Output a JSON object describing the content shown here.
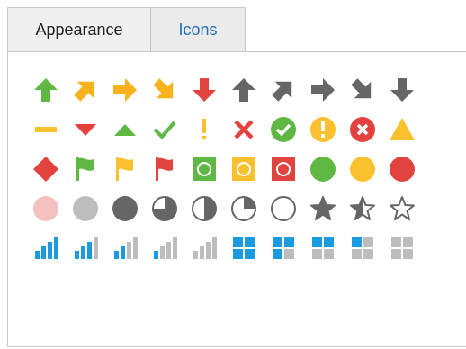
{
  "tabs": [
    {
      "label": "Appearance",
      "active": false
    },
    {
      "label": "Icons",
      "active": true
    }
  ],
  "colors": {
    "green": "#5fb843",
    "orange": "#f7b21e",
    "yellow": "#fbc02d",
    "red": "#e3433f",
    "gray": "#666666",
    "lightgray": "#bdbdbd",
    "pink": "#f4c0c0",
    "blue": "#1a9be0"
  },
  "icon_rows": [
    [
      "arrow-up-green-icon",
      "arrow-up-right-orange-icon",
      "arrow-right-orange-icon",
      "arrow-down-right-orange-icon",
      "arrow-down-red-icon",
      "arrow-up-gray-icon",
      "arrow-up-right-gray-icon",
      "arrow-right-gray-icon",
      "arrow-down-right-gray-icon",
      "arrow-down-gray-icon"
    ],
    [
      "dash-yellow-icon",
      "triangle-down-red-icon",
      "triangle-up-green-icon",
      "checkmark-green-icon",
      "exclamation-yellow-icon",
      "x-red-icon",
      "check-circle-green-icon",
      "exclamation-circle-yellow-icon",
      "x-circle-red-icon",
      "triangle-yellow-icon"
    ],
    [
      "diamond-red-icon",
      "flag-green-icon",
      "flag-yellow-icon",
      "flag-red-icon",
      "square-circle-green-icon",
      "square-circle-yellow-icon",
      "square-circle-red-icon",
      "circle-green-icon",
      "circle-yellow-icon",
      "circle-red-icon"
    ],
    [
      "circle-pink-icon",
      "circle-lightgray-icon",
      "circle-darkgray-icon",
      "pie-three-quarter-icon",
      "pie-half-icon",
      "pie-quarter-icon",
      "circle-empty-icon",
      "star-full-icon",
      "star-half-icon",
      "star-empty-icon"
    ],
    [
      "signal-4-bars-icon",
      "signal-3-bars-icon",
      "signal-2-bars-icon",
      "signal-1-bar-icon",
      "signal-0-bars-icon",
      "quad-4-blue-icon",
      "quad-3-blue-icon",
      "quad-2-blue-icon",
      "quad-1-blue-icon",
      "quad-0-blue-icon"
    ]
  ]
}
